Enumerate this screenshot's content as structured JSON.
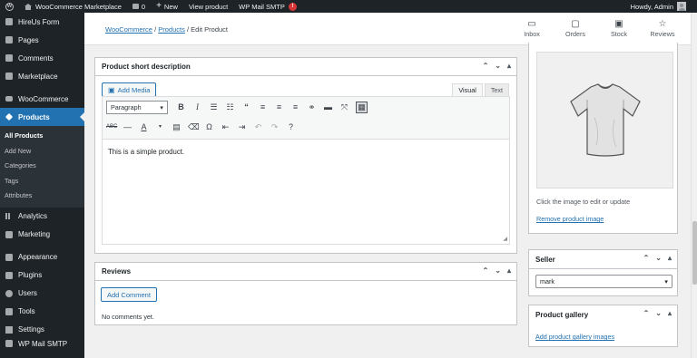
{
  "adminbar": {
    "site_name": "WooCommerce Marketplace",
    "comments_count": "0",
    "new_label": "New",
    "view_product": "View product",
    "wp_mail_smtp": "WP Mail SMTP",
    "smtp_badge": "!",
    "howdy": "Howdy, Admin"
  },
  "sidebar": {
    "items": [
      {
        "label": "HireUs Form",
        "icon": "form-icon"
      },
      {
        "label": "Pages",
        "icon": "pages-icon"
      },
      {
        "label": "Comments",
        "icon": "comments-icon"
      },
      {
        "label": "Marketplace",
        "icon": "marketplace-icon"
      },
      {
        "label": "WooCommerce",
        "icon": "woocommerce-icon"
      },
      {
        "label": "Products",
        "icon": "products-icon"
      }
    ],
    "submenu": [
      "All Products",
      "Add New",
      "Categories",
      "Tags",
      "Attributes"
    ],
    "items2": [
      {
        "label": "Analytics",
        "icon": "analytics-icon"
      },
      {
        "label": "Marketing",
        "icon": "marketing-icon"
      },
      {
        "label": "Appearance",
        "icon": "appearance-icon"
      },
      {
        "label": "Plugins",
        "icon": "plugins-icon"
      },
      {
        "label": "Users",
        "icon": "users-icon"
      },
      {
        "label": "Tools",
        "icon": "tools-icon"
      },
      {
        "label": "Settings",
        "icon": "settings-icon"
      },
      {
        "label": "WP Mail SMTP",
        "icon": "mail-icon"
      }
    ]
  },
  "breadcrumb": {
    "root": "WooCommerce",
    "sep1": "/",
    "parent": "Products",
    "sep2": "/",
    "current": "Edit Product"
  },
  "topnav": {
    "inbox": "Inbox",
    "orders": "Orders",
    "stock": "Stock",
    "reviews": "Reviews"
  },
  "short_desc": {
    "title": "Product short description",
    "add_media": "Add Media",
    "tab_visual": "Visual",
    "tab_text": "Text",
    "format_select": "Paragraph",
    "content": "This is a simple product."
  },
  "reviews": {
    "title": "Reviews",
    "add_comment": "Add Comment",
    "empty": "No comments yet."
  },
  "product_image": {
    "hint": "Click the image to edit or update",
    "remove": "Remove product image"
  },
  "seller": {
    "title": "Seller",
    "value": "mark"
  },
  "gallery": {
    "title": "Product gallery",
    "add": "Add product gallery images"
  }
}
